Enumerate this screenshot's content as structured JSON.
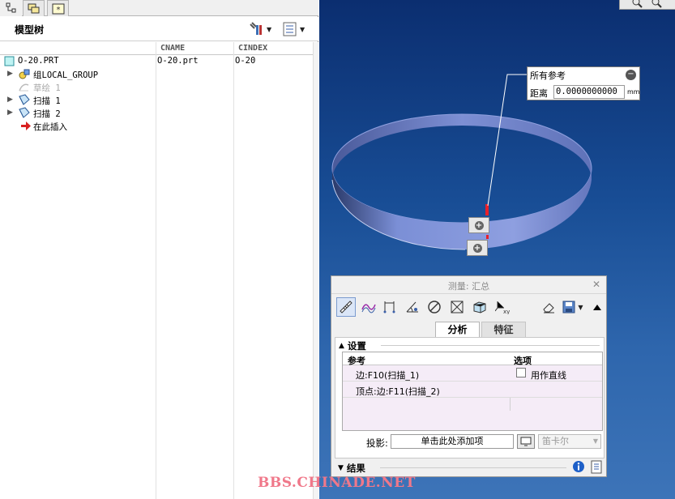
{
  "model_tree": {
    "title": "模型树",
    "columns": [
      "CNAME",
      "CINDEX"
    ],
    "rows": [
      {
        "label": "O-20.PRT",
        "cname": "O-20.prt",
        "cindex": "O-20",
        "icon": "part-icon",
        "expandable": false,
        "dimmed": false
      },
      {
        "label": "组LOCAL_GROUP",
        "cname": "",
        "cindex": "",
        "icon": "group-icon",
        "expandable": true,
        "dimmed": false
      },
      {
        "label": "草绘 1",
        "cname": "",
        "cindex": "",
        "icon": "sketch-icon",
        "expandable": false,
        "dimmed": true
      },
      {
        "label": "扫描 1",
        "cname": "",
        "cindex": "",
        "icon": "sweep-icon",
        "expandable": true,
        "dimmed": false
      },
      {
        "label": "扫描 2",
        "cname": "",
        "cindex": "",
        "icon": "sweep-icon",
        "expandable": true,
        "dimmed": false
      },
      {
        "label": "在此插入",
        "cname": "",
        "cindex": "",
        "icon": "insert-here-arrow-icon",
        "expandable": false,
        "dimmed": false
      }
    ]
  },
  "reference_popup": {
    "title": "所有参考",
    "distance_label": "距离",
    "distance_value": "0.0000000000",
    "unit": "mm"
  },
  "measure_dialog": {
    "title": "测量: 汇总",
    "tabs": [
      "分析",
      "特征"
    ],
    "setup_label": "设置",
    "table_headers": [
      "参考",
      "选项"
    ],
    "references": [
      {
        "ref": "边:F10(扫描_1)",
        "option": "用作直线"
      },
      {
        "ref": "顶点:边:F11(扫描_2)",
        "option": ""
      }
    ],
    "projection_label": "投影:",
    "projection_placeholder": "单击此处添加项",
    "coord_system": "笛卡尔",
    "results_label": "结果"
  },
  "watermark": "BBS.CHINADE.NET",
  "colors": {
    "viewport_top": "#0b2e70",
    "viewport_bottom": "#3d74b8",
    "ring": "#6a7fc7",
    "highlight": "#e8202a"
  }
}
